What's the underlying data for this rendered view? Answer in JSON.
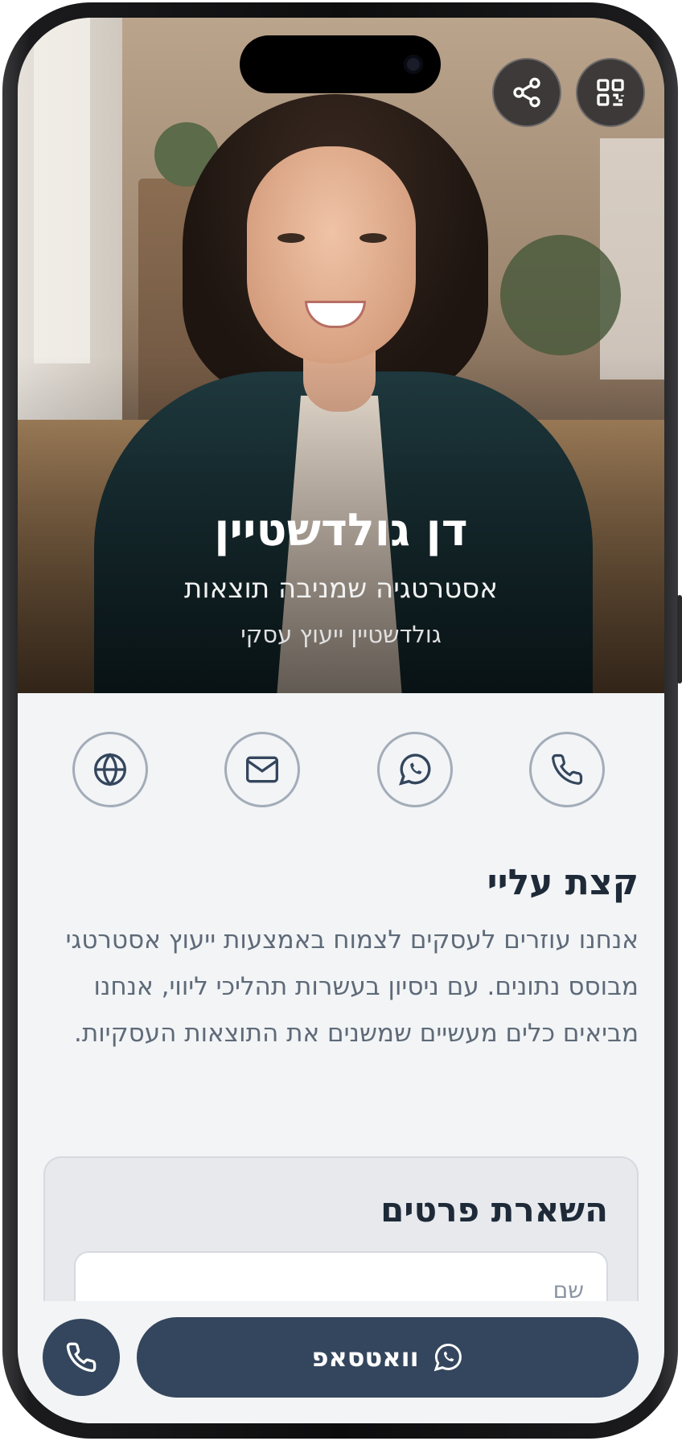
{
  "profile": {
    "name": "דן גולדשטיין",
    "tagline": "אסטרטגיה שמניבה תוצאות",
    "company": "גולדשטיין ייעוץ עסקי"
  },
  "top_actions": [
    {
      "icon": "share-icon"
    },
    {
      "icon": "qr-code-icon"
    }
  ],
  "contact_actions": [
    {
      "icon": "globe-icon"
    },
    {
      "icon": "mail-icon"
    },
    {
      "icon": "whatsapp-icon"
    },
    {
      "icon": "phone-icon"
    }
  ],
  "about": {
    "title": "קצת עליי",
    "text": "אנחנו עוזרים לעסקים לצמוח באמצעות ייעוץ אסטרטגי מבוסס נתונים. עם ניסיון בעשרות תהליכי ליווי, אנחנו מביאים כלים מעשיים שמשנים את התוצאות העסקיות."
  },
  "lead_form": {
    "title": "השארת פרטים",
    "name_placeholder": "שם"
  },
  "bottom_bar": {
    "whatsapp_label": "וואטסאפ"
  },
  "colors": {
    "primary": "#34465d",
    "background": "#f2f4f6",
    "heading": "#1e2a38",
    "body_text": "#5e6a78"
  }
}
